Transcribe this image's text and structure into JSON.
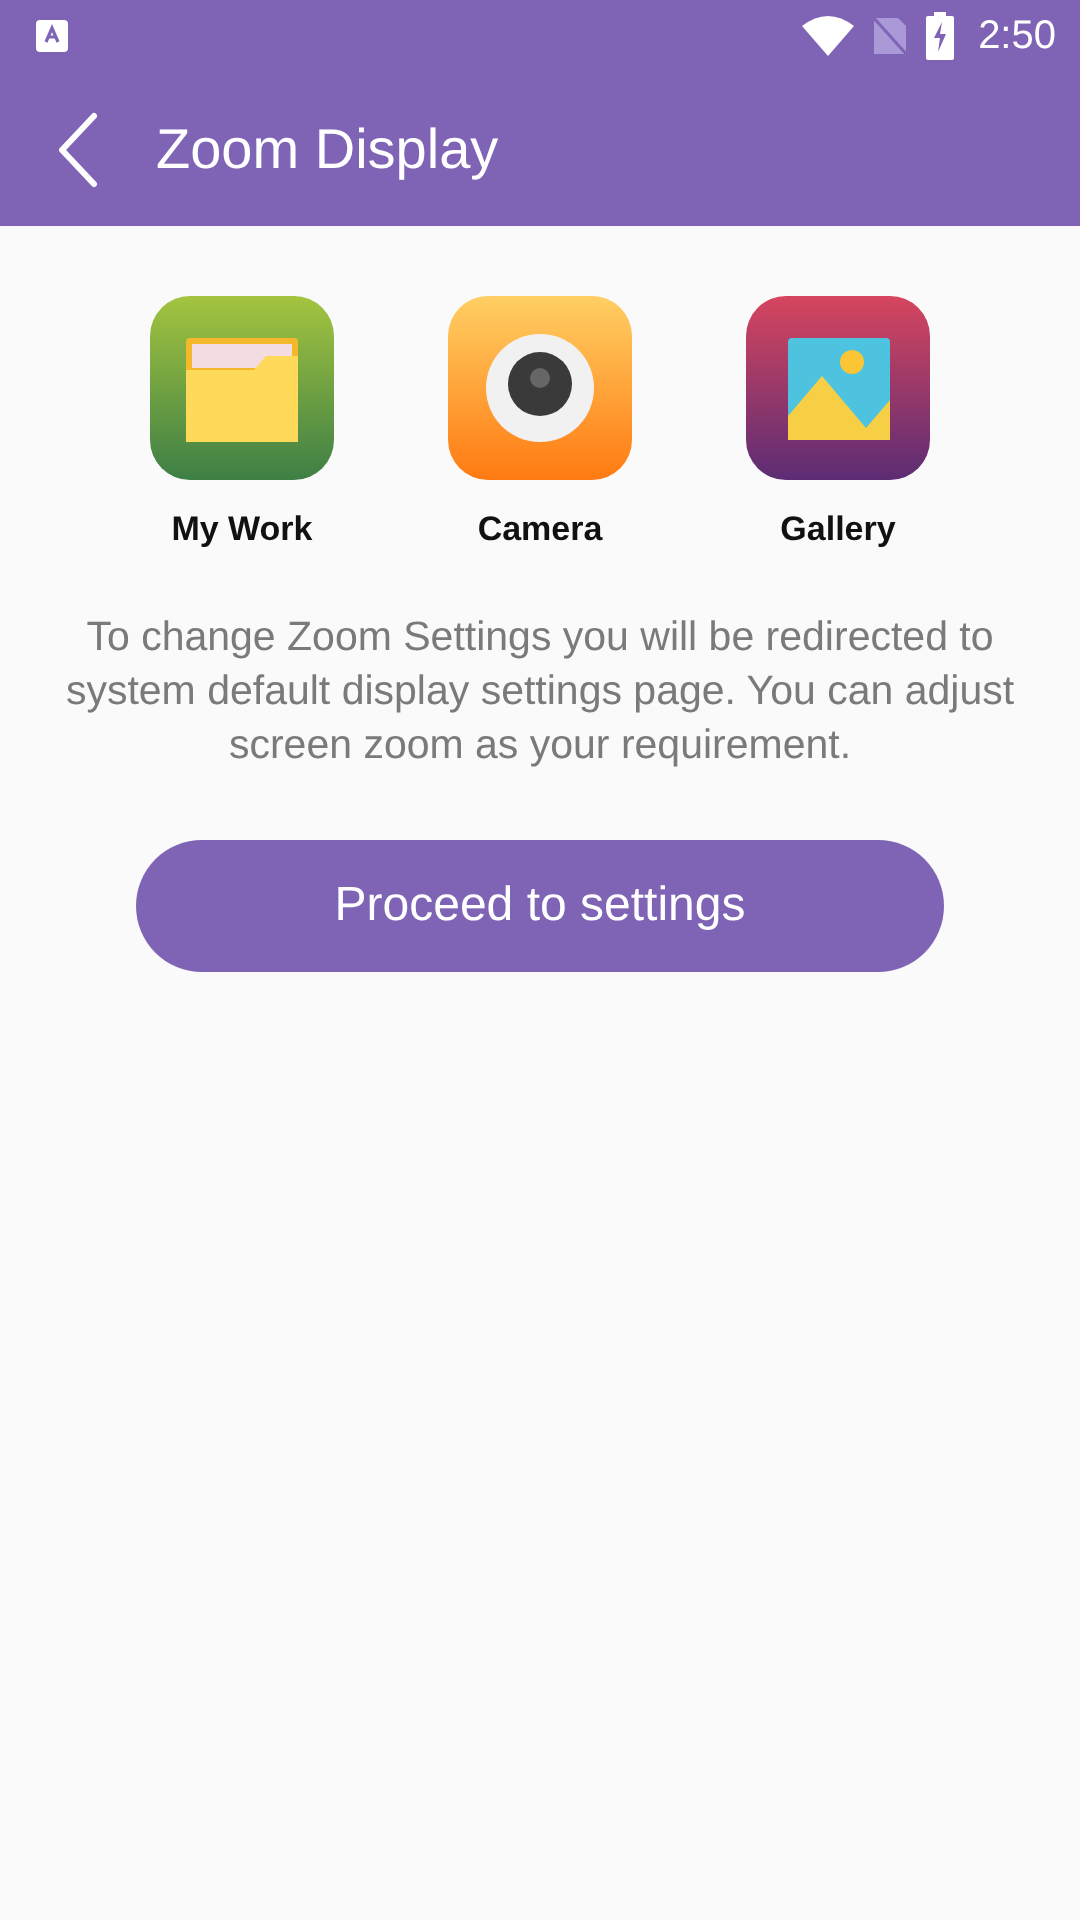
{
  "status_bar": {
    "time": "2:50"
  },
  "toolbar": {
    "title": "Zoom Display"
  },
  "apps": [
    {
      "kind": "folder",
      "label": "My Work"
    },
    {
      "kind": "camera",
      "label": "Camera"
    },
    {
      "kind": "gallery",
      "label": "Gallery"
    }
  ],
  "description": "To change Zoom Settings you will be redirected to system default display settings page. You can adjust screen zoom as your requirement.",
  "buttons": [
    "Proceed to settings"
  ]
}
